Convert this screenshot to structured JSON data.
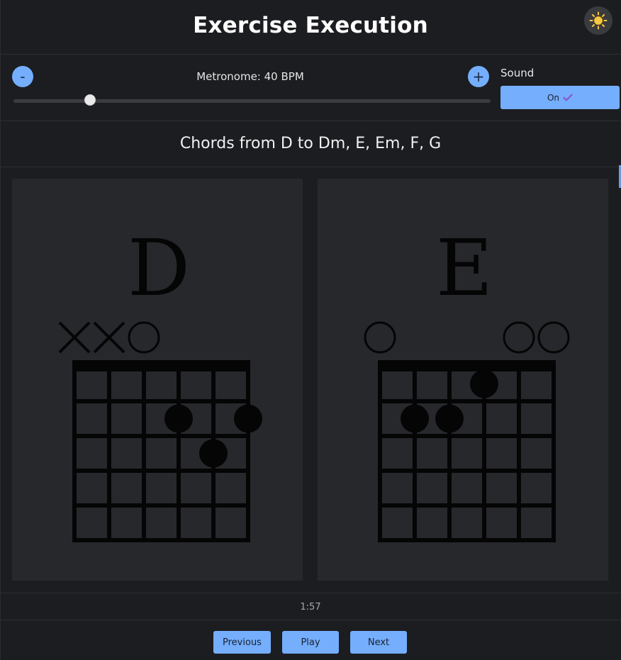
{
  "header": {
    "title": "Exercise Execution",
    "theme_icon": "sun-icon"
  },
  "metronome": {
    "decrease_label": "-",
    "increase_label": "+",
    "label": "Metronome: 40 BPM",
    "bpm": 40,
    "slider_fraction": 0.16
  },
  "sound": {
    "label": "Sound",
    "button_label": "On",
    "button_icon": "check-icon"
  },
  "exercise": {
    "title": "Chords from D to Dm, E, Em, F, G"
  },
  "chords": [
    {
      "name": "D",
      "markers": [
        "x",
        "x",
        "o",
        "",
        "",
        ""
      ],
      "dots": [
        {
          "string": 4,
          "fret": 2
        },
        {
          "string": 6,
          "fret": 2
        },
        {
          "string": 5,
          "fret": 3
        }
      ]
    },
    {
      "name": "E",
      "markers": [
        "o",
        "",
        "",
        "",
        "o",
        "o"
      ],
      "dots": [
        {
          "string": 4,
          "fret": 1
        },
        {
          "string": 2,
          "fret": 2
        },
        {
          "string": 3,
          "fret": 2
        }
      ]
    }
  ],
  "timer": "1:57",
  "controls": {
    "previous_label": "Previous",
    "play_label": "Play",
    "next_label": "Next"
  },
  "colors": {
    "accent": "#74aefc",
    "background": "#1c1d20",
    "card": "#27282b",
    "check": "#8a5cc8",
    "sun": "#f5c842"
  }
}
